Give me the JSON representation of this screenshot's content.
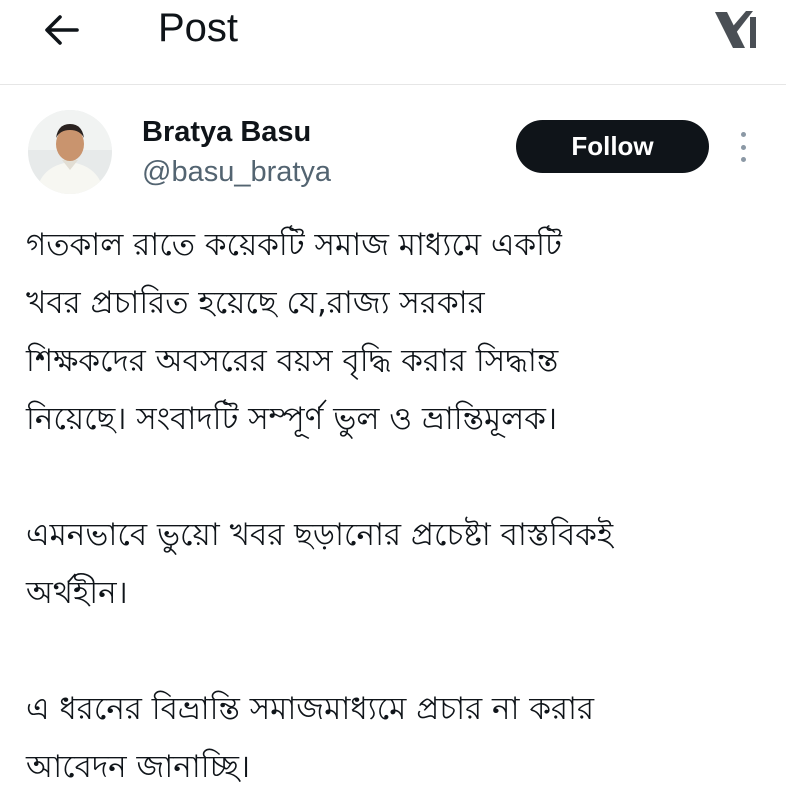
{
  "header": {
    "title": "Post",
    "back_icon": "arrow-left-icon",
    "logo_icon": "x-logo-icon"
  },
  "author": {
    "name": "Bratya Basu",
    "handle": "@basu_bratya",
    "avatar": "avatar-photo"
  },
  "actions": {
    "follow_label": "Follow",
    "more_icon": "more-vertical-icon"
  },
  "post": {
    "paragraphs": [
      "গতকাল রাতে কয়েকটি সমাজ মাধ্যমে একটি\nখবর প্রচারিত হয়েছে যে,রাজ্য সরকার\nশিক্ষকদের অবসরের বয়স বৃদ্ধি করার সিদ্ধান্ত\nনিয়েছে। সংবাদটি সম্পূর্ণ ভুল ও ভ্রান্তিমূলক।",
      "এমনভাবে ভুয়ো খবর ছড়ানোর প্রচেষ্টা বাস্তবিকই\nঅর্থহীন।",
      "এ ধরনের বিভ্রান্তি সমাজমাধ্যমে প্রচার না করার\nআবেদন জানাচ্ছি।"
    ]
  },
  "colors": {
    "text": "#0f1419",
    "secondary_text": "#536471",
    "follow_bg": "#0f1419",
    "follow_text": "#ffffff",
    "divider": "#e6e6e6"
  }
}
